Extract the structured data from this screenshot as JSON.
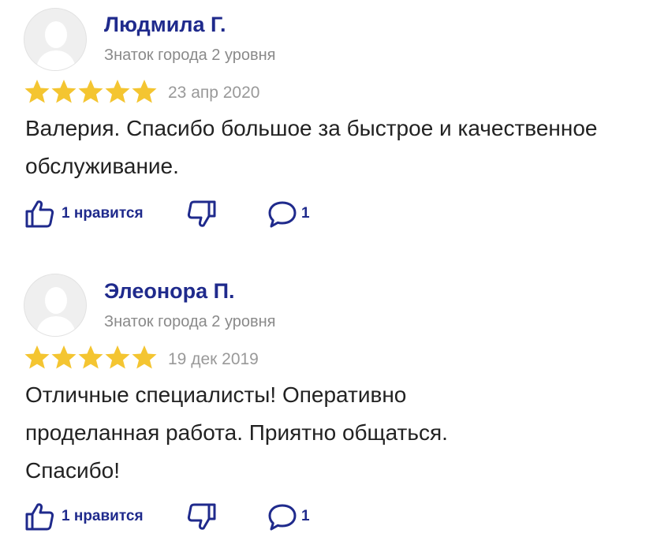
{
  "reviews": [
    {
      "author": "Людмила Г.",
      "level": "Знаток города 2 уровня",
      "rating": 5,
      "date": "23 апр 2020",
      "text": "Валерия. Спасибо большое за быстрое и качественное обслуживание.",
      "likes_label": "1 нравится",
      "comments_count": "1"
    },
    {
      "author": "Элеонора П.",
      "level": "Знаток города 2 уровня",
      "rating": 5,
      "date": "19 дек 2019",
      "text": "Отличные специалисты! Оперативно проделанная работа. Приятно общаться. Спасибо!",
      "likes_label": "1 нравится",
      "comments_count": "1"
    }
  ],
  "colors": {
    "accent": "#1f2a8c",
    "star": "#f4c531",
    "muted": "#8a8a8a"
  },
  "icons": [
    "avatar-placeholder-icon",
    "star-icon",
    "thumbs-up-icon",
    "thumbs-down-icon",
    "comment-icon"
  ]
}
